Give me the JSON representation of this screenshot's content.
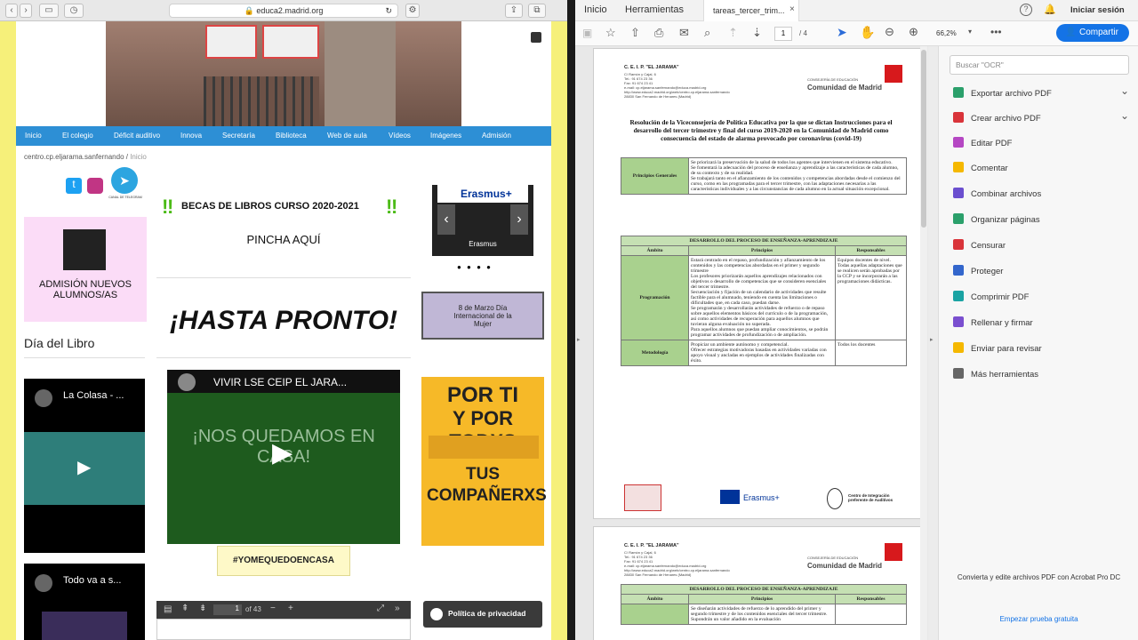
{
  "safari": {
    "url": "educa2.madrid.org"
  },
  "site": {
    "breadcrumb": "centro.cp.eljarama.sanfernando",
    "breadcrumb_current": "Inicio",
    "nav": [
      "Inicio",
      "El colegio",
      "Déficit auditivo",
      "Innova",
      "Secretaría",
      "Biblioteca",
      "Web de aula",
      "Vídeos",
      "Imágenes",
      "Admisión"
    ],
    "telegram_label": "CANAL DE TELEGRAM",
    "admision": "ADMISIÓN NUEVOS ALUMNOS/AS",
    "dia_libro": "Día del Libro",
    "video1_title": "La Colasa - ...",
    "video2_title": "Todo va a s...",
    "becas": "BECAS DE LIBROS CURSO 2020-2021",
    "pincha": "PINCHA AQUÍ",
    "hasta": "¡HASTA PRONTO!",
    "yt_title": "VIVIR LSE CEIP EL JARA...",
    "yt_overlay": "¡NOS QUEDAMOS EN CASA!",
    "hashtag": "#YOMEQUEDOENCASA",
    "erasmus": "Erasmus+",
    "erasmus_caption": "Erasmus",
    "mujer": "8 de Marzo Día Internacional de la Mujer",
    "por_ti_1": "POR TI",
    "por_ti_2": "Y POR TODXS",
    "por_ti_3": "TUS COMPAÑERXS",
    "pdf_page": "1",
    "pdf_of": "of 43",
    "privacidad": "Política de privacidad"
  },
  "acrobat": {
    "tabs": [
      "Inicio",
      "Herramientas",
      "tareas_tercer_trim..."
    ],
    "login": "Iniciar sesión",
    "page_current": "1",
    "page_total": "/ 4",
    "zoom": "66,2%",
    "share": "Compartir",
    "search_placeholder": "Buscar \"OCR\"",
    "tools": [
      "Exportar archivo PDF",
      "Crear archivo PDF",
      "Editar PDF",
      "Comentar",
      "Combinar archivos",
      "Organizar páginas",
      "Censurar",
      "Proteger",
      "Comprimir PDF",
      "Rellenar y firmar",
      "Enviar para revisar",
      "Más herramientas"
    ],
    "tool_colors": [
      "#2ba06b",
      "#d9343a",
      "#b547c3",
      "#f5b800",
      "#6b4fcf",
      "#2ba06b",
      "#d9343a",
      "#3366cc",
      "#1aa3a3",
      "#7a4fcf",
      "#f5b800",
      "#666666"
    ],
    "promo": "Convierta y edite archivos PDF con Acrobat Pro DC",
    "trial": "Empezar prueba gratuita"
  },
  "doc": {
    "school": "C. E. I. P. \"EL JARAMA\"",
    "address": "C/ Ramón y Cajal, 6",
    "tel": "Tel.: 91 674 23 36",
    "fax": "Fax: 91 674 23 41",
    "email": "e-mail: cp.eljarama.sanfernando@educa.madrid.org",
    "web": "http://www.educa2.madrid.org/web/centro.cp.eljarama.sanfernando",
    "city": "28830 San Fernando de Henares (Madrid)",
    "consejeria": "CONSEJERÍA DE EDUCACIÓN",
    "comunidad": "Comunidad de Madrid",
    "title": "Resolución de la Viceconsejería de Política Educativa por la que se dictan Instrucciones para el desarrollo del tercer trimestre y final del curso 2019-2020 en la Comunidad de Madrid como consecuencia del estado de alarma provocado por coronavirus (covid-19)",
    "principios_label": "Principios Generales",
    "principios": [
      "Se priorizará la preservación de la salud de todos los agentes que intervienen en el sistema educativo.",
      "Se fomentará la adecuación del proceso de enseñanza y aprendizaje a las características de cada alumno, de su contexto y de su realidad.",
      "Se trabajará tanto en el afianzamiento de los contenidos y competencias abordadas desde el comienzo del curso, como en las programadas para el tercer trimestre, con las adaptaciones necesarias a las características individuales y a las circunstancias de cada alumno en la actual situación excepcional."
    ],
    "desarrollo": "DESARROLLO DEL PROCESO DE ENSEÑANZA-APRENDIZAJE",
    "col_ambito": "Ámbito",
    "col_principios": "Principios",
    "col_responsables": "Responsables",
    "programacion": "Programación",
    "prog_items": [
      "Estará centrado en el repaso, profundización y afianzamiento de los contenidos y las competencias abordadas en el primer y segundo trimestre",
      "Los profesores priorizarán aquellos aprendizajes relacionados con objetivos o desarrollo de competencias que se consideren esenciales del tercer trimestre.",
      "Secuenciación y fijación de un calendario de actividades que resulte factible para el alumnado, teniendo en cuenta las limitaciones o dificultades que, en cada caso, puedan darse.",
      "Se programarán y desarrollarán actividades de refuerzo o de repaso sobre aquellos elementos básicos del currículo o de la programación, así como actividades de recuperación para aquellos alumnos que tuvieran alguna evaluación no superada.",
      "Para aquellos alumnos que puedan ampliar conocimientos, se podrán programar actividades de profundización o de ampliación."
    ],
    "prog_resp": [
      "Equipos docentes de nivel.",
      "Todas aquellas adaptaciones que se realicen serán aprobadas por la CCP y se incorporarán a las programaciones didácticas."
    ],
    "metodologia": "Metodología",
    "met_items": [
      "Propiciar un ambiente autónomo y competencial.",
      "Ofrecer estrategias motivadoras basadas en actividades variadas con apoyo visual y ancladas en ejemplos de actividades finalizadas con éxito."
    ],
    "met_resp": "Todos los docentes",
    "footer_erasmus": "Erasmus+",
    "footer_centro": "Centro de Integración preferente de Auditivos",
    "p2_items": [
      "Se diseñarán actividades de refuerzo de lo aprendido del primer y segundo trimestre y de los contenidos esenciales del tercer trimestre.",
      "Supondrán un valor añadido en la evaluación"
    ]
  }
}
